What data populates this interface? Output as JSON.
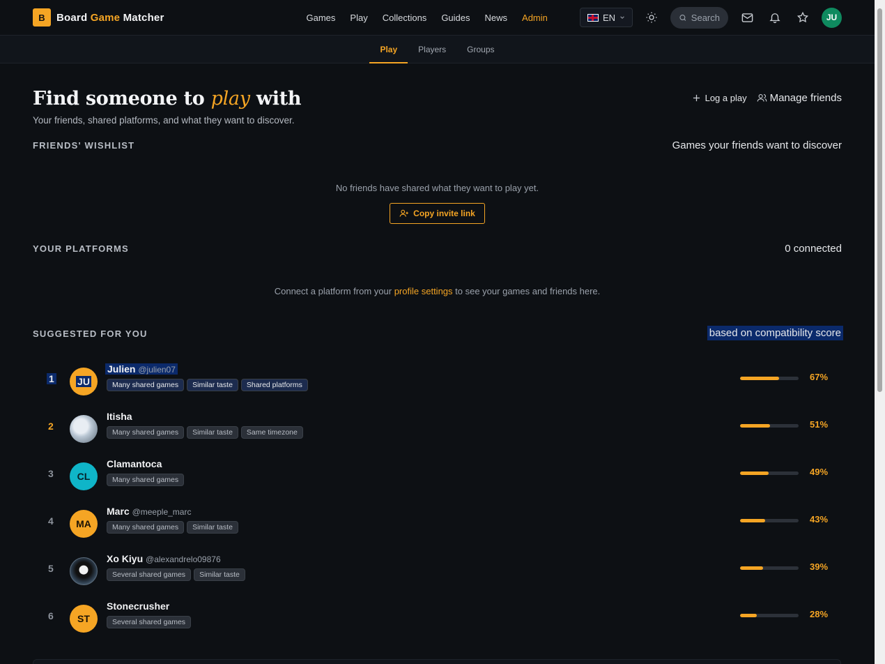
{
  "brand": {
    "logo_letter": "B",
    "word1": "Board",
    "word2": "Game",
    "word3": "Matcher"
  },
  "nav": {
    "links": [
      "Games",
      "Play",
      "Collections",
      "Guides",
      "News",
      "Admin"
    ],
    "lang": "EN",
    "search_placeholder": "Search",
    "user_initials": "JU"
  },
  "subnav": {
    "tabs": [
      "Play",
      "Players",
      "Groups"
    ],
    "active": "Play"
  },
  "hero": {
    "title_before": "Find someone to",
    "title_em": "play",
    "title_after": "with",
    "subtitle": "Your friends, shared platforms, and what they want to discover.",
    "action_log": "Log a play",
    "action_friends": "Manage friends"
  },
  "wishlist": {
    "heading": "FRIENDS' WISHLIST",
    "right": "Games your friends want to discover",
    "empty": "No friends have shared what they want to play yet.",
    "invite_button": "Copy invite link"
  },
  "platforms": {
    "heading": "YOUR PLATFORMS",
    "right": "0 connected",
    "text_before": "Connect a platform from your",
    "link": "profile settings",
    "text_after": "to see your games and friends here."
  },
  "suggested": {
    "heading": "SUGGESTED FOR YOU",
    "right": "based on compatibility score",
    "rows": [
      {
        "rank": "1",
        "initials": "JU",
        "name": "Julien",
        "handle": "@julien07",
        "tags": [
          "Many shared games",
          "Similar taste",
          "Shared platforms"
        ],
        "score": 67,
        "score_label": "67%"
      },
      {
        "rank": "2",
        "initials": "",
        "name": "Itisha",
        "handle": "",
        "tags": [
          "Many shared games",
          "Similar taste",
          "Same timezone"
        ],
        "score": 51,
        "score_label": "51%"
      },
      {
        "rank": "3",
        "initials": "CL",
        "name": "Clamantoca",
        "handle": "",
        "tags": [
          "Many shared games"
        ],
        "score": 49,
        "score_label": "49%"
      },
      {
        "rank": "4",
        "initials": "MA",
        "name": "Marc",
        "handle": "@meeple_marc",
        "tags": [
          "Many shared games",
          "Similar taste"
        ],
        "score": 43,
        "score_label": "43%"
      },
      {
        "rank": "5",
        "initials": "",
        "name": "Xo Kiyu",
        "handle": "@alexandrelo09876",
        "tags": [
          "Several shared games",
          "Similar taste"
        ],
        "score": 39,
        "score_label": "39%"
      },
      {
        "rank": "6",
        "initials": "ST",
        "name": "Stonecrusher",
        "handle": "",
        "tags": [
          "Several shared games"
        ],
        "score": 28,
        "score_label": "28%"
      }
    ]
  },
  "colors": {
    "accent": "#f5a524",
    "background": "#0d1014",
    "avatar_green": "#0f8a5f",
    "avatar_teal": "#0fb5c8"
  }
}
